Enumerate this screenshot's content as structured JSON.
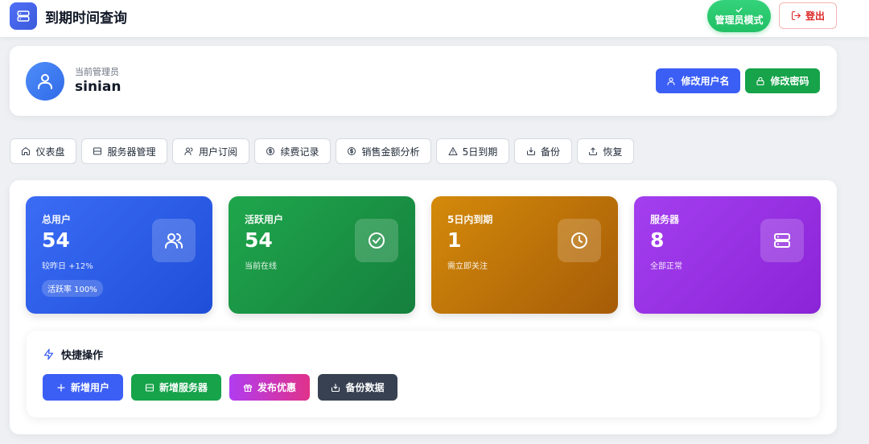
{
  "app": {
    "title": "到期时间查询",
    "logo_icon": "server-icon"
  },
  "header": {
    "admin_mode_label": "管理员模式",
    "logout_label": "登出"
  },
  "profile": {
    "label": "当前管理员",
    "username": "sinian",
    "edit_username_label": "修改用户名",
    "edit_password_label": "修改密码"
  },
  "nav": {
    "tabs": [
      {
        "label": "仪表盘",
        "icon": "home-icon"
      },
      {
        "label": "服务器管理",
        "icon": "server-icon"
      },
      {
        "label": "用户订阅",
        "icon": "users-icon"
      },
      {
        "label": "续费记录",
        "icon": "dollar-icon"
      },
      {
        "label": "销售金额分析",
        "icon": "dollar-icon"
      },
      {
        "label": "5日到期",
        "icon": "warning-icon"
      },
      {
        "label": "备份",
        "icon": "download-icon"
      },
      {
        "label": "恢复",
        "icon": "upload-icon"
      }
    ]
  },
  "stats": [
    {
      "title": "总用户",
      "value": "54",
      "sub": "较昨日 +12%",
      "pill": "活跃率 100%",
      "icon": "users-icon",
      "colors": [
        "#3b6cf6",
        "#1f4fd8"
      ]
    },
    {
      "title": "活跃用户",
      "value": "54",
      "sub": "当前在线",
      "icon": "check-circle-icon",
      "colors": [
        "#1fa64c",
        "#15803d"
      ]
    },
    {
      "title": "5日内到期",
      "value": "1",
      "sub": "需立即关注",
      "icon": "clock-icon",
      "colors": [
        "#d48a0a",
        "#a65c07"
      ]
    },
    {
      "title": "服务器",
      "value": "8",
      "sub": "全部正常",
      "icon": "server-icon",
      "colors": [
        "#a43ff0",
        "#8a24d6"
      ]
    }
  ],
  "quick_actions": {
    "title": "快捷操作",
    "buttons": [
      {
        "label": "新增用户",
        "icon": "plus-icon",
        "color": "#3b5ff5"
      },
      {
        "label": "新增服务器",
        "icon": "server-icon",
        "color": "#16a34a"
      },
      {
        "label": "发布优惠",
        "icon": "gift-icon",
        "colors": [
          "#b13cf0",
          "#e0328a"
        ]
      },
      {
        "label": "备份数据",
        "icon": "download-icon",
        "color": "#374151"
      }
    ]
  }
}
